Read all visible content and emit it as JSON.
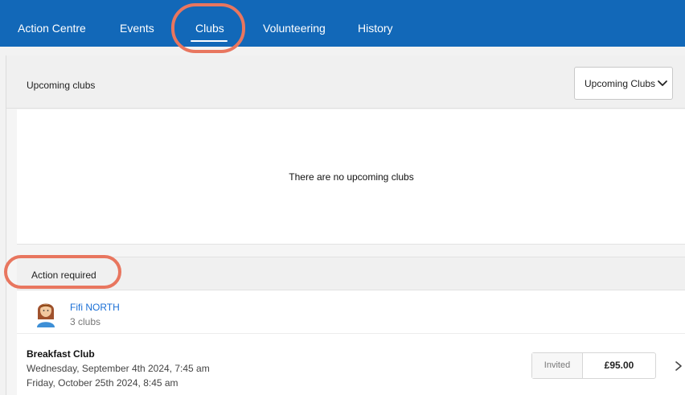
{
  "nav": {
    "tabs": [
      {
        "label": "Action Centre"
      },
      {
        "label": "Events"
      },
      {
        "label": "Clubs",
        "active": true
      },
      {
        "label": "Volunteering"
      },
      {
        "label": "History"
      }
    ],
    "background_color": "#1268b8"
  },
  "upcoming": {
    "title": "Upcoming clubs",
    "dropdown_value": "Upcoming Clubs",
    "empty_message": "There are no upcoming clubs"
  },
  "action_required": {
    "title": "Action required",
    "person": {
      "name": "Fifi NORTH",
      "subtitle": "3 clubs",
      "avatar_icon": "child-avatar-icon"
    },
    "club": {
      "name": "Breakfast Club",
      "date_line_1": "Wednesday, September 4th 2024, 7:45 am",
      "date_line_2": "Friday, October 25th 2024, 8:45 am",
      "status": "Invited",
      "price": "£95.00"
    }
  },
  "annotation_color": "#e8765f"
}
